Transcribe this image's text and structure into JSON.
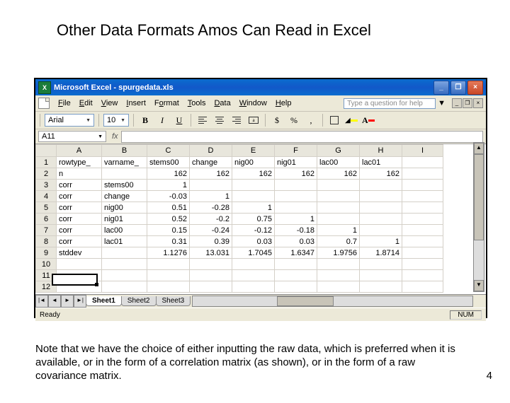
{
  "slide": {
    "title": "Other Data Formats Amos Can Read in Excel",
    "note": "Note that we have the choice of either inputting the raw data, which is preferred when it is available, or in the form of a correlation matrix (as shown), or in the form of a raw covariance matrix.",
    "page_number": "4"
  },
  "excel": {
    "titlebar": {
      "app": "Microsoft Excel",
      "filename": "spurgedata.xls",
      "logo_letter": "X"
    },
    "win_buttons": {
      "min": "_",
      "max": "❐",
      "close": "×"
    },
    "menubar": {
      "items": [
        "File",
        "Edit",
        "View",
        "Insert",
        "Format",
        "Tools",
        "Data",
        "Window",
        "Help"
      ],
      "help_placeholder": "Type a question for help"
    },
    "toolbar": {
      "font_name": "Arial",
      "font_size": "10",
      "bold": "B",
      "italic": "I",
      "underline": "U",
      "currency": "$",
      "percent": "%",
      "comma": ",",
      "font_color_letter": "A"
    },
    "namebox": {
      "cell_ref": "A11",
      "fx_label": "fx"
    },
    "columns": [
      "A",
      "B",
      "C",
      "D",
      "E",
      "F",
      "G",
      "H",
      "I"
    ],
    "rows": [
      {
        "n": "1",
        "cells": [
          "rowtype_",
          "varname_",
          "stems00",
          "change",
          "nig00",
          "nig01",
          "lac00",
          "lac01",
          ""
        ]
      },
      {
        "n": "2",
        "cells": [
          "n",
          "",
          "162",
          "162",
          "162",
          "162",
          "162",
          "162",
          ""
        ]
      },
      {
        "n": "3",
        "cells": [
          "corr",
          "stems00",
          "1",
          "",
          "",
          "",
          "",
          "",
          ""
        ]
      },
      {
        "n": "4",
        "cells": [
          "corr",
          "change",
          "-0.03",
          "1",
          "",
          "",
          "",
          "",
          ""
        ]
      },
      {
        "n": "5",
        "cells": [
          "corr",
          "nig00",
          "0.51",
          "-0.28",
          "1",
          "",
          "",
          "",
          ""
        ]
      },
      {
        "n": "6",
        "cells": [
          "corr",
          "nig01",
          "0.52",
          "-0.2",
          "0.75",
          "1",
          "",
          "",
          ""
        ]
      },
      {
        "n": "7",
        "cells": [
          "corr",
          "lac00",
          "0.15",
          "-0.24",
          "-0.12",
          "-0.18",
          "1",
          "",
          ""
        ]
      },
      {
        "n": "8",
        "cells": [
          "corr",
          "lac01",
          "0.31",
          "0.39",
          "0.03",
          "0.03",
          "0.7",
          "1",
          ""
        ]
      },
      {
        "n": "9",
        "cells": [
          "stddev",
          "",
          "1.1276",
          "13.031",
          "1.7045",
          "1.6347",
          "1.9756",
          "1.8714",
          ""
        ]
      },
      {
        "n": "10",
        "cells": [
          "",
          "",
          "",
          "",
          "",
          "",
          "",
          "",
          ""
        ]
      },
      {
        "n": "11",
        "cells": [
          "",
          "",
          "",
          "",
          "",
          "",
          "",
          "",
          ""
        ]
      },
      {
        "n": "12",
        "cells": [
          "",
          "",
          "",
          "",
          "",
          "",
          "",
          "",
          ""
        ]
      }
    ],
    "sheet_tabs": [
      "Sheet1",
      "Sheet2",
      "Sheet3"
    ],
    "statusbar": {
      "ready": "Ready",
      "num": "NUM"
    }
  }
}
